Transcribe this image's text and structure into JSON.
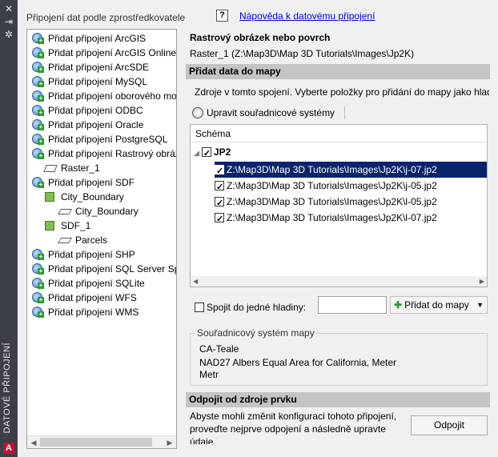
{
  "palette": {
    "strip": "#3c3f46",
    "selection": "#0a246a",
    "link": "#0000cc",
    "section_bar": "#c4c4c4"
  },
  "strip": {
    "title": "DATOVÉ PŘIPOJENÍ",
    "logo": "A",
    "icons": [
      "close-icon",
      "autohide-icon",
      "properties-icon"
    ]
  },
  "header": {
    "label": "Připojení dat podle zprostředkovatele",
    "help_icon": "?",
    "help_link": "Nápověda k datovému připojení"
  },
  "tree": {
    "items": [
      {
        "label": "Přidat připojení ArcGIS",
        "icon": "globe-add-icon"
      },
      {
        "label": "Přidat připojení ArcGIS Online",
        "icon": "globe-add-icon"
      },
      {
        "label": "Přidat připojení ArcSDE",
        "icon": "globe-add-icon"
      },
      {
        "label": "Přidat připojení MySQL",
        "icon": "globe-add-icon"
      },
      {
        "label": "Přidat připojení oborového modelu",
        "icon": "globe-add-icon"
      },
      {
        "label": "Přidat připojení ODBC",
        "icon": "globe-add-icon"
      },
      {
        "label": "Přidat připojení Oracle",
        "icon": "globe-add-icon"
      },
      {
        "label": "Přidat připojení PostgreSQL",
        "icon": "globe-add-icon"
      },
      {
        "label": "Přidat připojení Rastrový obrázek",
        "icon": "globe-add-icon"
      },
      {
        "label": "Raster_1",
        "icon": "raster-icon"
      },
      {
        "label": "Přidat připojení SDF",
        "icon": "globe-add-icon"
      },
      {
        "label": "City_Boundary",
        "icon": "sdf-icon"
      },
      {
        "label": "City_Boundary",
        "icon": "feature-class-icon"
      },
      {
        "label": "SDF_1",
        "icon": "sdf-icon"
      },
      {
        "label": "Parcels",
        "icon": "feature-class-icon"
      },
      {
        "label": "Přidat připojení SHP",
        "icon": "globe-add-icon"
      },
      {
        "label": "Přidat připojení SQL Server Spatial",
        "icon": "globe-add-icon"
      },
      {
        "label": "Přidat připojení SQLite",
        "icon": "globe-add-icon"
      },
      {
        "label": "Přidat připojení WFS",
        "icon": "globe-add-icon"
      },
      {
        "label": "Přidat připojení WMS",
        "icon": "globe-add-icon"
      }
    ]
  },
  "source": {
    "title": "Rastrový obrázek nebo povrch",
    "path": "Raster_1 (Z:\\Map3D\\Map 3D Tutorials\\Images\\Jp2K)"
  },
  "add_section": {
    "bar": "Přidat data do mapy",
    "instructions": "Zdroje v tomto spojení. Vyberte položky pro přidání do mapy jako hladiny.",
    "coord_button": "Upravit souřadnicové systémy",
    "schema_header": "Schéma",
    "root": "JP2",
    "files": [
      "Z:\\Map3D\\Map 3D Tutorials\\Images\\Jp2K\\j-07.jp2",
      "Z:\\Map3D\\Map 3D Tutorials\\Images\\Jp2K\\j-05.jp2",
      "Z:\\Map3D\\Map 3D Tutorials\\Images\\Jp2K\\l-05.jp2",
      "Z:\\Map3D\\Map 3D Tutorials\\Images\\Jp2K\\l-07.jp2"
    ],
    "merge_label": "Spojit do jedné hladiny:",
    "merge_value": "",
    "add_button": "Přidat do mapy"
  },
  "coord_system": {
    "legend": "Souřadnicový systém mapy",
    "code": "CA-Teale",
    "description": "NAD27 Albers Equal Area for California, Meter",
    "unit": "Metr"
  },
  "disconnect": {
    "bar": "Odpojit od zdroje prvku",
    "text": "Abyste mohli změnit konfiguraci tohoto připojení, proveďte nejprve odpojení a následně upravte údaje.",
    "button": "Odpojit"
  }
}
